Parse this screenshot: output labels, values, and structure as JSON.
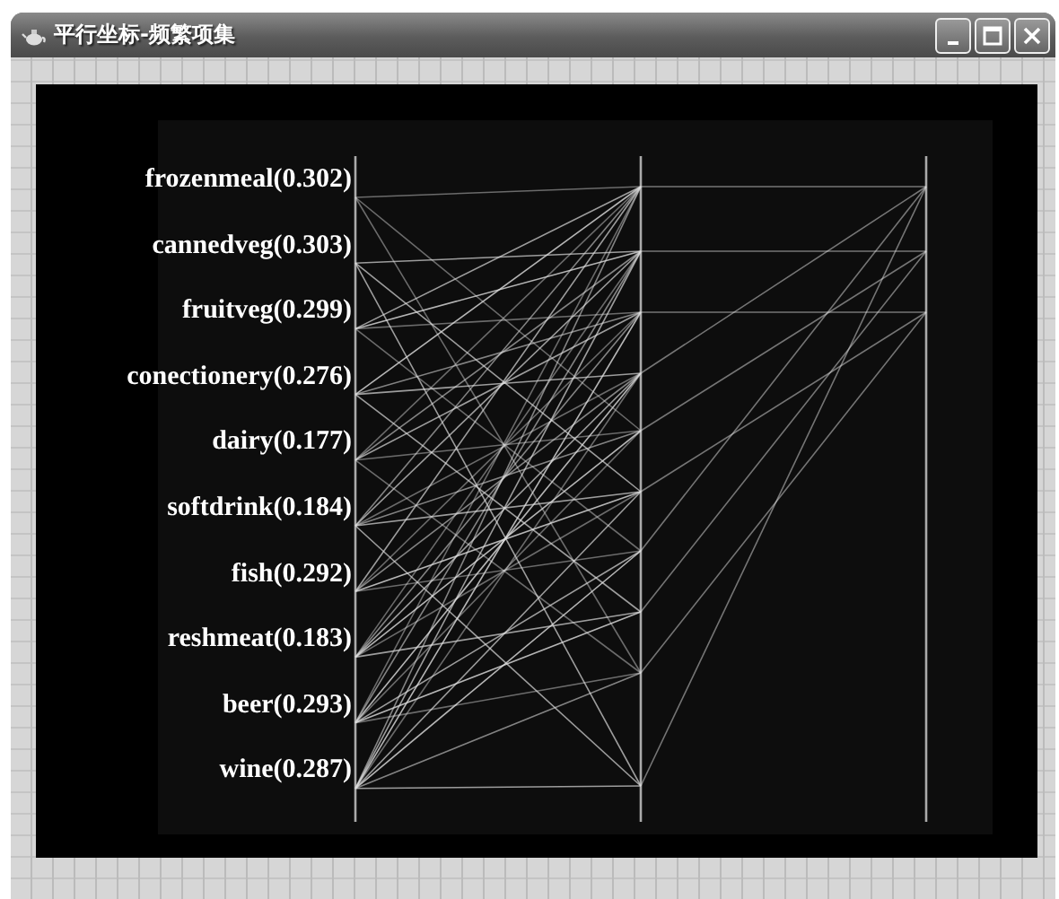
{
  "window": {
    "title": "平行坐标-频繁项集"
  },
  "plot": {
    "axis_labels": [
      "frozenmeal(0.302)",
      "cannedveg(0.303)",
      "fruitveg(0.299)",
      "conectionery(0.276)",
      "dairy(0.177)",
      "softdrink(0.184)",
      "fish(0.292)",
      "reshmeat(0.183)",
      "beer(0.293)",
      "wine(0.287)"
    ]
  }
}
